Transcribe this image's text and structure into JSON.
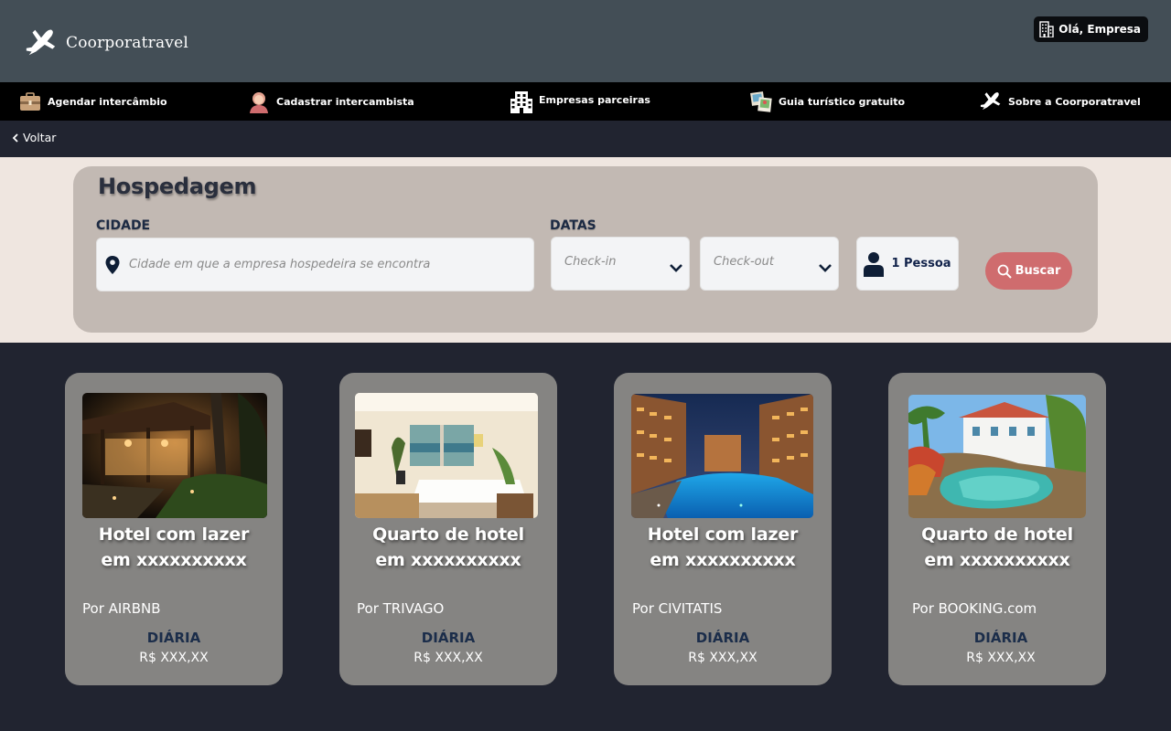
{
  "header": {
    "brand": "Coorporatravel",
    "greeting": "Olá, Empresa"
  },
  "nav": {
    "items": [
      {
        "label": "Agendar intercâmbio",
        "icon": "briefcase-icon"
      },
      {
        "label": "Cadastrar intercambista",
        "icon": "person-icon"
      },
      {
        "label": "Empresas parceiras",
        "icon": "building-icon"
      },
      {
        "label": "Guia turístico gratuito",
        "icon": "map-photos-icon"
      },
      {
        "label": "Sobre a Coorporatravel",
        "icon": "airplane-icon"
      }
    ]
  },
  "subbar": {
    "back_label": "Voltar"
  },
  "search": {
    "title": "Hospedagem",
    "city_label": "CIDADE",
    "city_placeholder": "Cidade em que a empresa hospedeira se encontra",
    "dates_label": "DATAS",
    "checkin_placeholder": "Check-in",
    "checkout_placeholder": "Check-out",
    "guests": "1 Pessoa",
    "button_label": "Buscar",
    "accent_color": "#cf6c6e"
  },
  "cards": [
    {
      "title_line1": "Hotel com lazer",
      "title_line2": "em xxxxxxxxxx",
      "provider": "Por AIRBNB",
      "rate_label": "DIÁRIA",
      "price": "R$ XXX,XX",
      "image": "garden-night-photo"
    },
    {
      "title_line1": "Quarto de hotel",
      "title_line2": "em xxxxxxxxxx",
      "provider": "Por TRIVAGO",
      "rate_label": "DIÁRIA",
      "price": "R$ XXX,XX",
      "image": "hotel-room-photo"
    },
    {
      "title_line1": "Hotel com lazer",
      "title_line2": "em xxxxxxxxxx",
      "provider": "Por CIVITATIS",
      "rate_label": "DIÁRIA",
      "price": "R$ XXX,XX",
      "image": "pool-night-photo"
    },
    {
      "title_line1": "Quarto de hotel",
      "title_line2": "em xxxxxxxxxx",
      "provider": "Por BOOKING.com",
      "rate_label": "DIÁRIA",
      "price": "R$ XXX,XX",
      "image": "resort-pool-photo"
    }
  ]
}
